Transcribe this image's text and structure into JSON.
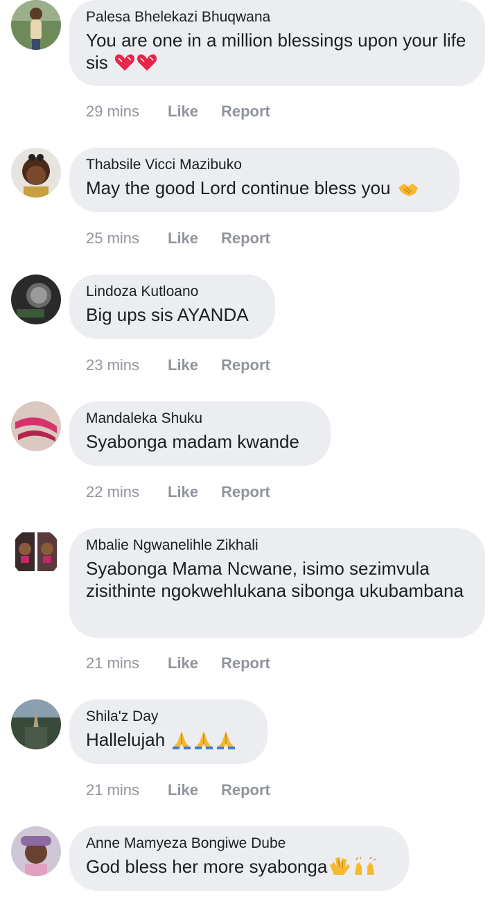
{
  "comments": [
    {
      "author": "Palesa Bhelekazi Bhuqwana",
      "text": "You are one in a million blessings upon your life sis",
      "emoji": [
        "heart",
        "heart"
      ],
      "time": "29 mins",
      "like_label": "Like",
      "report_label": "Report"
    },
    {
      "author": "Thabsile Vicci Mazibuko",
      "text": "May the good Lord continue bless you",
      "emoji": [
        "handshake"
      ],
      "time": "25 mins",
      "like_label": "Like",
      "report_label": "Report"
    },
    {
      "author": "Lindoza Kutloano",
      "text": "Big ups sis AYANDA",
      "emoji": [],
      "time": "23 mins",
      "like_label": "Like",
      "report_label": "Report"
    },
    {
      "author": "Mandaleka Shuku",
      "text": "Syabonga madam kwande",
      "emoji": [],
      "time": "22 mins",
      "like_label": "Like",
      "report_label": "Report"
    },
    {
      "author": "Mbalie Ngwanelihle Zikhali",
      "text": "Syabonga Mama Ncwane, isimo sezimvula zisithinte ngokwehlukana sibonga ukubambana",
      "emoji": [],
      "time": "21 mins",
      "like_label": "Like",
      "report_label": "Report"
    },
    {
      "author": "Shila'z Day",
      "text": "Hallelujah",
      "emoji": [
        "pray",
        "pray",
        "pray"
      ],
      "time": "21 mins",
      "like_label": "Like",
      "report_label": "Report"
    },
    {
      "author": "Anne Mamyeza Bongiwe Dube",
      "text": "God bless her more syabonga",
      "emoji": [
        "clap",
        "raised-hands"
      ],
      "time": "",
      "like_label": "",
      "report_label": ""
    }
  ]
}
